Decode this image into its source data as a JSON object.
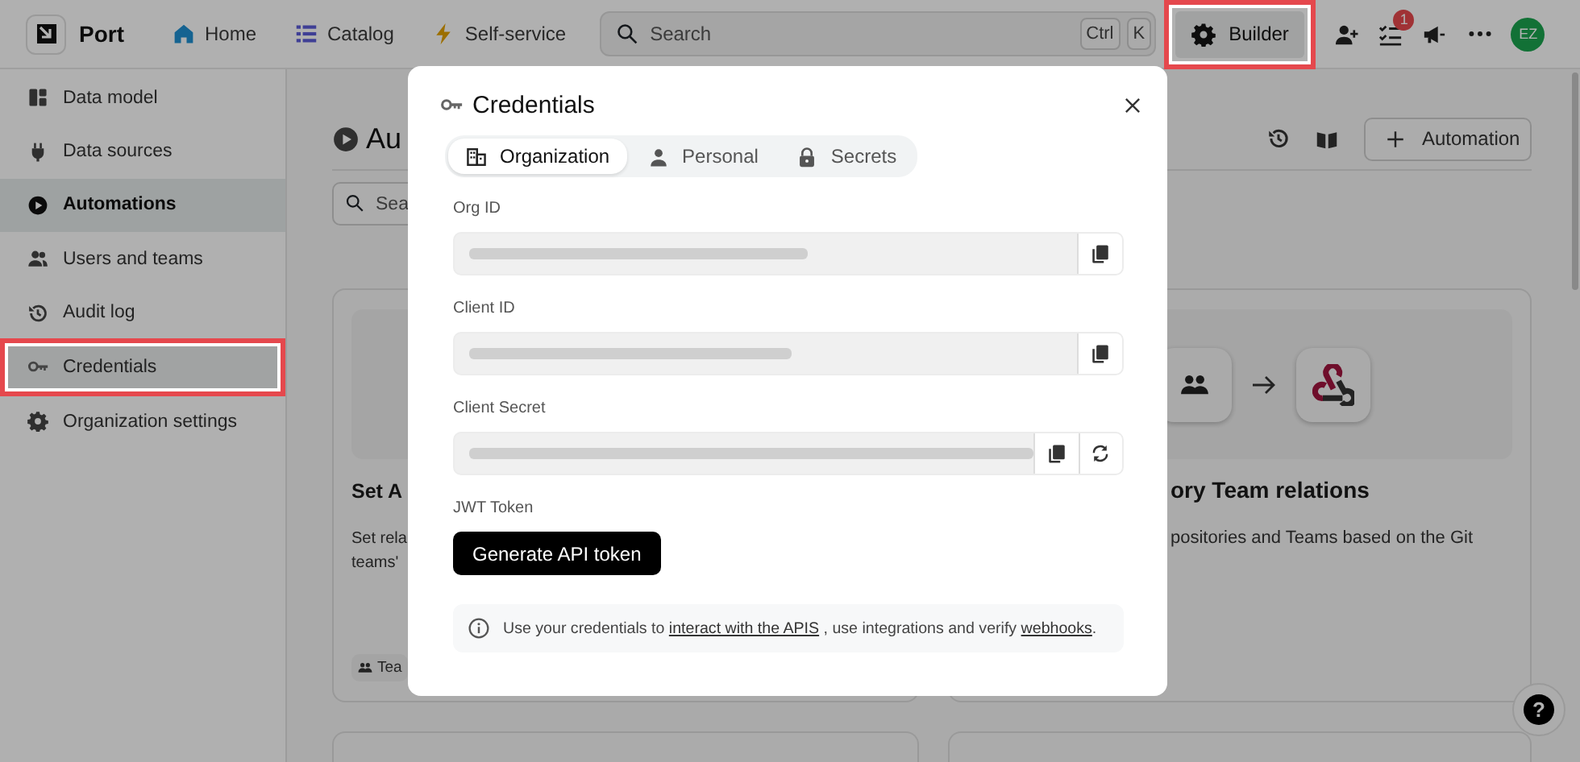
{
  "top_bar": {
    "logo_text": "Port",
    "nav": [
      {
        "label": "Home"
      },
      {
        "label": "Catalog"
      },
      {
        "label": "Self-service"
      }
    ],
    "search": {
      "placeholder": "Search",
      "shortcut": [
        "Ctrl",
        "K"
      ]
    },
    "builder_button": {
      "label": "Builder",
      "highlighted": true
    },
    "notification_count": "1",
    "avatar": "EZ"
  },
  "sidebar": {
    "items": [
      {
        "label": "Data model",
        "selected": false,
        "highlighted": false
      },
      {
        "label": "Data sources",
        "selected": false,
        "highlighted": false
      },
      {
        "label": "Automations",
        "selected": true,
        "highlighted": false
      },
      {
        "label": "Users and teams",
        "selected": false,
        "highlighted": false
      },
      {
        "label": "Audit log",
        "selected": false,
        "highlighted": false
      },
      {
        "label": "Credentials",
        "selected": false,
        "highlighted": true
      },
      {
        "label": "Organization settings",
        "selected": false,
        "highlighted": false
      }
    ]
  },
  "main": {
    "title": "Au",
    "new_button": "Automation",
    "search": {
      "placeholder": "Sea"
    },
    "cards": [
      {
        "title": "Set A",
        "description_lines": [
          "Set rela",
          "teams'"
        ],
        "tag": "Tea"
      },
      {
        "title": "ory Team relations",
        "description_lines": [
          "positories and Teams based on the Git"
        ]
      }
    ]
  },
  "modal": {
    "title": "Credentials",
    "tabs": [
      {
        "label": "Organization",
        "selected": true
      },
      {
        "label": "Personal",
        "selected": false
      },
      {
        "label": "Secrets",
        "selected": false
      }
    ],
    "fields": [
      {
        "label": "Org ID",
        "kind": "copyable"
      },
      {
        "label": "Client ID",
        "kind": "copyable"
      },
      {
        "label": "Client Secret",
        "kind": "regenerable"
      }
    ],
    "jwt_label": "JWT Token",
    "generate_button": "Generate API token",
    "info": [
      {
        "kind": "text",
        "text": "Use your credentials to "
      },
      {
        "kind": "link",
        "text": "interact with the APIS"
      },
      {
        "kind": "text",
        "text": " , use integrations and verify "
      },
      {
        "kind": "link",
        "text": "webhooks"
      },
      {
        "kind": "text",
        "text": "."
      }
    ]
  },
  "help_button": "?"
}
